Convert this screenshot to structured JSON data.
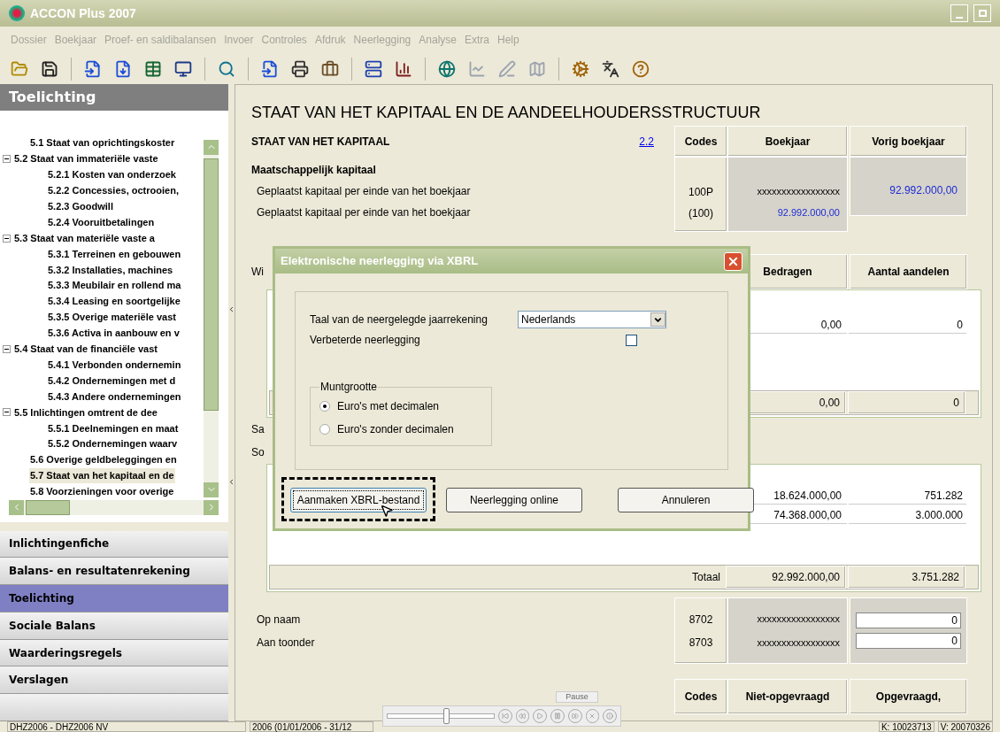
{
  "window": {
    "title": "ACCON Plus 2007"
  },
  "menu": [
    {
      "label": "Dossier",
      "disabled": true
    },
    {
      "label": "Boekjaar",
      "disabled": true
    },
    {
      "label": "Proef- en saldibalansen",
      "disabled": true
    },
    {
      "label": "Invoer",
      "disabled": true
    },
    {
      "label": "Controles",
      "disabled": true
    },
    {
      "label": "Afdruk",
      "disabled": true
    },
    {
      "label": "Neerlegging",
      "disabled": true
    },
    {
      "label": "Analyse",
      "disabled": true
    },
    {
      "label": "Extra",
      "disabled": true
    },
    {
      "label": "Help",
      "disabled": true
    }
  ],
  "sidebar": {
    "title": "Toelichting",
    "tree": [
      {
        "label": "5.1 Staat van oprichtingskoster",
        "selected": false
      },
      {
        "label": "5.2 Staat van immateriële vaste",
        "selected": false,
        "expanded": true,
        "children": [
          {
            "label": "5.2.1 Kosten van onderzoek",
            "selected": false
          },
          {
            "label": "5.2.2 Concessies, octrooien,",
            "selected": false
          },
          {
            "label": "5.2.3 Goodwill",
            "selected": false
          },
          {
            "label": "5.2.4 Vooruitbetalingen",
            "selected": false
          }
        ]
      },
      {
        "label": "5.3 Staat van materiële vaste a",
        "selected": false,
        "expanded": true,
        "children": [
          {
            "label": "5.3.1 Terreinen en gebouwen",
            "selected": false
          },
          {
            "label": "5.3.2 Installaties, machines",
            "selected": false
          },
          {
            "label": "5.3.3 Meubilair en rollend ma",
            "selected": false
          },
          {
            "label": "5.3.4 Leasing en soortgelijke",
            "selected": false
          },
          {
            "label": "5.3.5 Overige materiële vast",
            "selected": false
          },
          {
            "label": "5.3.6 Activa in aanbouw en v",
            "selected": false
          }
        ]
      },
      {
        "label": "5.4 Staat van de financiële vast",
        "selected": false,
        "expanded": true,
        "children": [
          {
            "label": "5.4.1 Verbonden ondernemin",
            "selected": false
          },
          {
            "label": "5.4.2 Ondernemingen met d",
            "selected": false
          },
          {
            "label": "5.4.3 Andere ondernemingen",
            "selected": false
          }
        ]
      },
      {
        "label": "5.5 Inlichtingen omtrent de dee",
        "selected": false,
        "expanded": true,
        "children": [
          {
            "label": "5.5.1 Deelnemingen en maat",
            "selected": false
          },
          {
            "label": "5.5.2 Ondernemingen waarv",
            "selected": false
          }
        ]
      },
      {
        "label": "5.6 Overige geldbeleggingen en",
        "selected": false
      },
      {
        "label": "5.7 Staat van het kapitaal en de",
        "selected": true
      },
      {
        "label": "5.8 Voorzieningen voor overige",
        "selected": false
      }
    ],
    "nav": [
      {
        "label": "Inlichtingenfiche",
        "selected": false
      },
      {
        "label": "Balans- en resultatenrekening",
        "selected": false
      },
      {
        "label": "Toelichting",
        "selected": true
      },
      {
        "label": "Sociale Balans",
        "selected": false
      },
      {
        "label": "Waarderingsregels",
        "selected": false
      },
      {
        "label": "Verslagen",
        "selected": false
      }
    ]
  },
  "page_title": "STAAT VAN HET KAPITAAL EN DE AANDEELHOUDERSSTRUCTUUR",
  "section": {
    "title": "STAAT VAN HET KAPITAAL",
    "link": "2.2",
    "columns": [
      "Codes",
      "Boekjaar",
      "Vorig boekjaar"
    ]
  },
  "capital": {
    "heading": "Maatschappelijk kapitaal",
    "rows": [
      {
        "label": "Geplaatst kapitaal per einde van het boekjaar",
        "code": "100P",
        "current": "xxxxxxxxxxxxxxxxx",
        "previous": "92.992.000,00"
      },
      {
        "label": "Geplaatst kapitaal per einde van het boekjaar",
        "code": "(100)",
        "current": "92.992.000,00"
      }
    ]
  },
  "changes": {
    "label": "Wi",
    "columns": [
      "Bedragen",
      "Aantal aandelen"
    ],
    "row": {
      "amount": "0,00",
      "shares": "0"
    },
    "subtotal": {
      "amount": "0,00",
      "shares": "0"
    }
  },
  "shares": {
    "labels": [
      "Sa",
      "So"
    ],
    "rows": [
      {
        "amount": "18.624.000,00",
        "shares": "751.282"
      },
      {
        "amount": "74.368.000,00",
        "shares": "3.000.000"
      }
    ],
    "total": {
      "label": "Totaal",
      "amount": "92.992.000,00",
      "shares": "3.751.282"
    }
  },
  "registered": [
    {
      "label": "Op naam",
      "code": "8702",
      "current": "xxxxxxxxxxxxxxxxx",
      "value": "0"
    },
    {
      "label": "Aan toonder",
      "code": "8703",
      "current": "xxxxxxxxxxxxxxxxx",
      "value": "0"
    }
  ],
  "bottom_header": [
    "Codes",
    "Niet-opgevraagd",
    "Opgevraagd,"
  ],
  "dialog": {
    "title": "Elektronische neerlegging via XBRL",
    "language": {
      "label": "Taal van de neergelegde jaarrekening",
      "value": "Nederlands"
    },
    "corrected": {
      "label": "Verbeterde neerlegging",
      "checked": false
    },
    "currency": {
      "legend": "Muntgrootte",
      "options": [
        {
          "label": "Euro's met decimalen",
          "selected": true
        },
        {
          "label": "Euro's zonder decimalen",
          "selected": false
        }
      ]
    },
    "buttons": [
      {
        "label": "Aanmaken XBRL-bestand",
        "highlighted": true
      },
      {
        "label": "Neerlegging online",
        "highlighted": false
      },
      {
        "label": "Annuleren",
        "highlighted": false
      }
    ]
  },
  "player": {
    "button": "Pause",
    "level": 0.55
  },
  "status_bar": [
    "DHZ2006 - DHZ2006 NV",
    "2006 (01/01/2006 - 31/12",
    "K: 10023713",
    "V: 20070326"
  ]
}
